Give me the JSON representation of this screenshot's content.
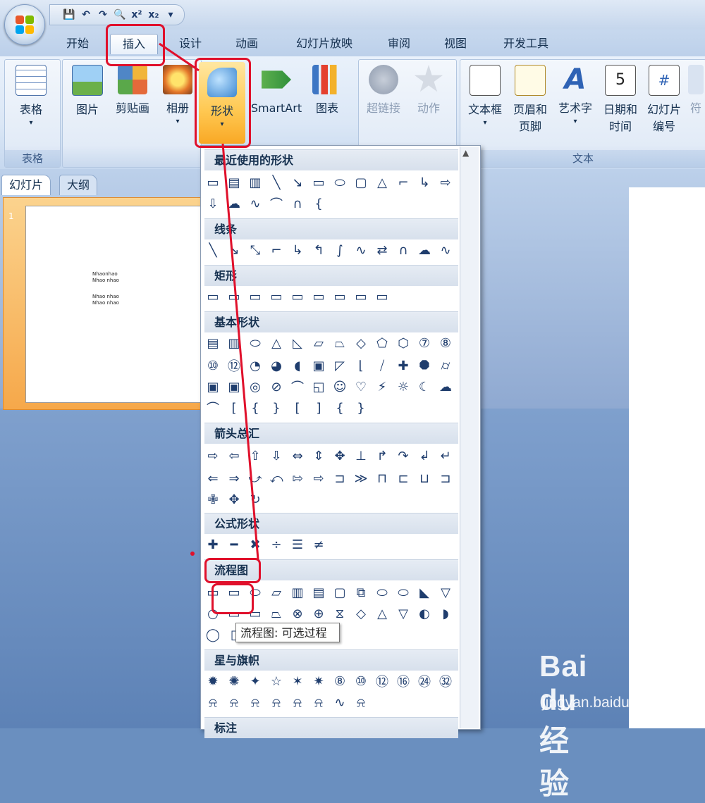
{
  "quick_access": [
    "💾",
    "↶",
    "↷",
    "🔍",
    "x²",
    "x₂",
    "▾"
  ],
  "tabs": [
    "开始",
    "插入",
    "设计",
    "动画",
    "幻灯片放映",
    "审阅",
    "视图",
    "开发工具"
  ],
  "ribbon": {
    "groups": {
      "table": "表格",
      "text": "文本"
    },
    "buttons": {
      "table": "表格",
      "picture": "图片",
      "clipart": "剪贴画",
      "album": "相册",
      "shapes": "形状",
      "smartart": "SmartArt",
      "chart": "图表",
      "hyperlink": "超链接",
      "action": "动作",
      "textbox": "文本框",
      "header_footer_1": "页眉和",
      "header_footer_2": "页脚",
      "wordart": "艺术字",
      "datetime_1": "日期和",
      "datetime_2": "时间",
      "slidenum_1": "幻灯片",
      "slidenum_2": "编号",
      "symbol": "符"
    }
  },
  "pane": {
    "tab_slides": "幻灯片",
    "tab_outline": "大纲",
    "slide_number": "1",
    "thumb_lines": [
      "Nhaonhao",
      "Nhao nhao",
      "Nhao nhao",
      "Nhao nhao"
    ]
  },
  "shapes_menu": {
    "sections": [
      "最近使用的形状",
      "线条",
      "矩形",
      "基本形状",
      "箭头总汇",
      "公式形状",
      "流程图",
      "星与旗帜",
      "标注"
    ],
    "tooltip": "流程图: 可选过程"
  },
  "watermark": {
    "logo": "Bai du 经验",
    "url": "jingyan.baidu.com"
  },
  "colors": {
    "annotation_red": "#e0102b",
    "ribbon_bg": "#dbe7f6",
    "workspace_blue": "#6a8fbf"
  }
}
